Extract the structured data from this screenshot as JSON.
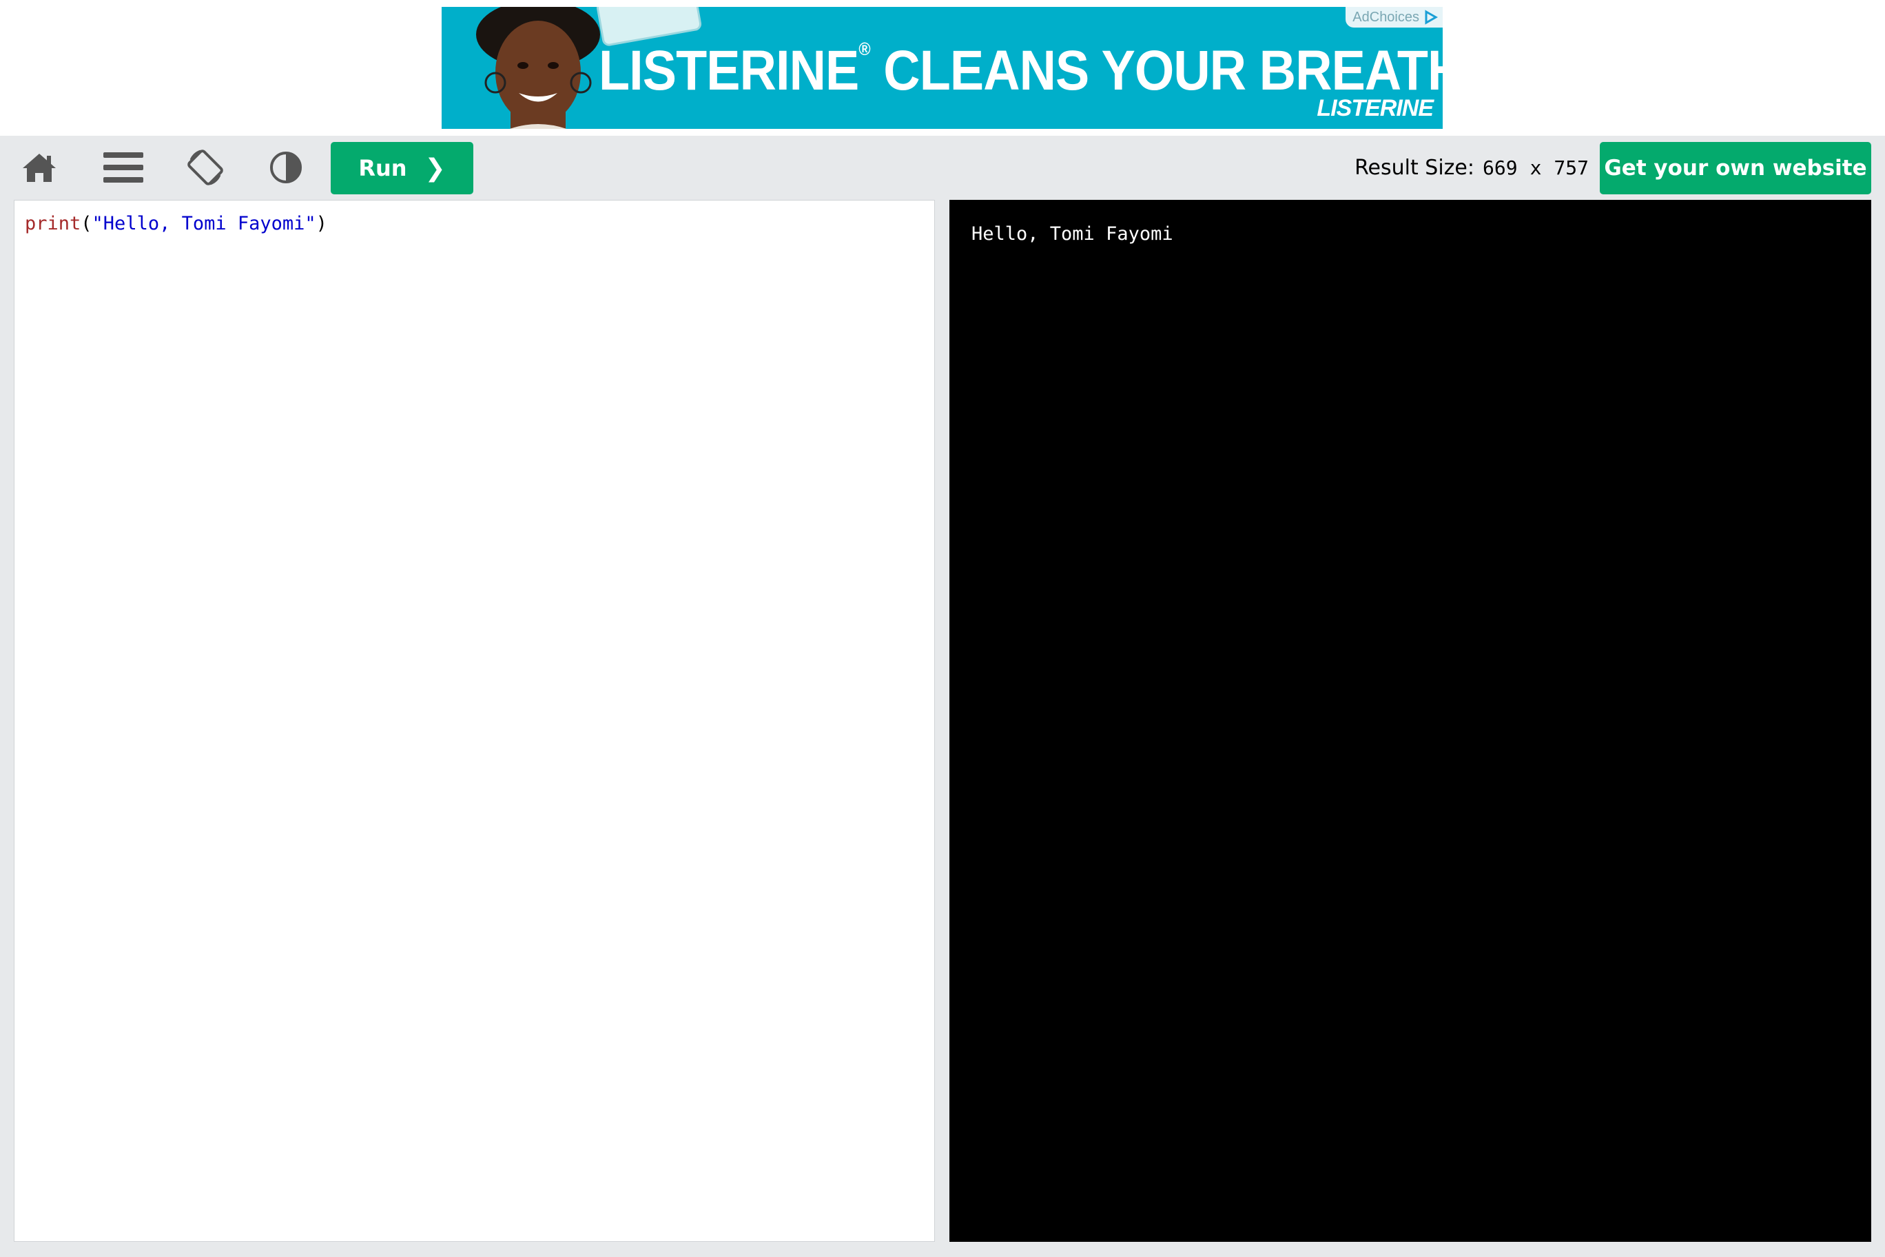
{
  "ad": {
    "headline": "LISTERINE",
    "registered": "®",
    "headline_rest": " CLEANS YOUR BREATH",
    "brand": "LISTERINE",
    "ad_choices": "AdChoices",
    "background_color": "#00afca"
  },
  "toolbar": {
    "icons": [
      "home-icon",
      "menu-icon",
      "rotate-icon",
      "contrast-icon"
    ],
    "run_label": "Run",
    "run_chevron": "❯",
    "result_size_label": "Result Size:",
    "result_width": "669",
    "result_x": "x",
    "result_height": "757",
    "get_website_label": "Get your own website",
    "accent_color": "#04aa6d"
  },
  "editor": {
    "code_func": "print",
    "code_open": "(",
    "code_string": "\"Hello, Tomi Fayomi\"",
    "code_close": ")"
  },
  "output": {
    "text": "Hello, Tomi Fayomi"
  }
}
